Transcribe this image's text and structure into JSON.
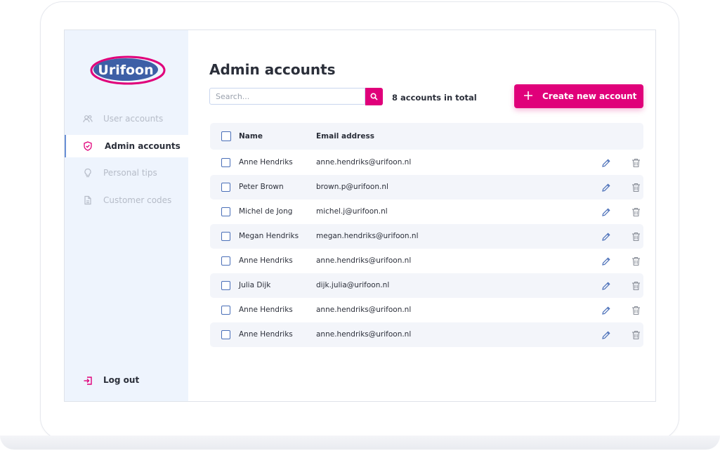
{
  "brand": {
    "logo_text": "Urifoon",
    "accent": "#e0007a",
    "logo_blue": "#3d5fa6"
  },
  "sidebar": {
    "items": [
      {
        "label": "User accounts",
        "icon": "users-icon",
        "active": false
      },
      {
        "label": "Admin accounts",
        "icon": "shield-icon",
        "active": true
      },
      {
        "label": "Personal tips",
        "icon": "lightbulb-icon",
        "active": false
      },
      {
        "label": "Customer codes",
        "icon": "document-icon",
        "active": false
      }
    ],
    "logout_label": "Log out"
  },
  "main": {
    "title": "Admin accounts",
    "search": {
      "placeholder": "Search..."
    },
    "count_text": "8 accounts in total",
    "create_label": "Create new account",
    "table": {
      "columns": [
        "Name",
        "Email address"
      ],
      "rows": [
        {
          "name": "Anne Hendriks",
          "email": "anne.hendriks@urifoon.nl"
        },
        {
          "name": "Peter Brown",
          "email": "brown.p@urifoon.nl"
        },
        {
          "name": "Michel de Jong",
          "email": "michel.j@urifoon.nl"
        },
        {
          "name": "Megan Hendriks",
          "email": "megan.hendriks@urifoon.nl"
        },
        {
          "name": "Anne Hendriks",
          "email": "anne.hendriks@urifoon.nl"
        },
        {
          "name": "Julia Dijk",
          "email": "dijk.julia@urifoon.nl"
        },
        {
          "name": "Anne Hendriks",
          "email": "anne.hendriks@urifoon.nl"
        },
        {
          "name": "Anne Hendriks",
          "email": "anne.hendriks@urifoon.nl"
        }
      ]
    }
  }
}
